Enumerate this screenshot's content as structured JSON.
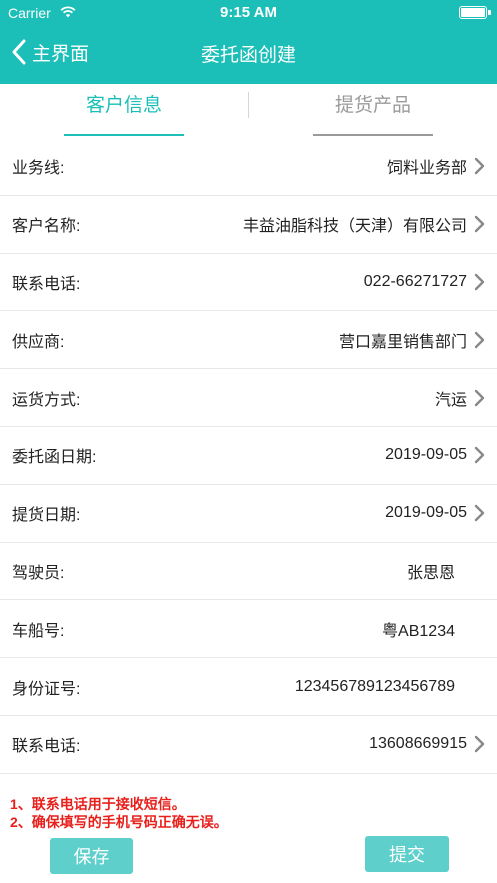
{
  "status": {
    "carrier": "Carrier",
    "time": "9:15 AM"
  },
  "nav": {
    "back_label": "主界面",
    "title": "委托函创建"
  },
  "tabs": [
    {
      "label": "客户信息",
      "active": true
    },
    {
      "label": "提货产品",
      "active": false
    }
  ],
  "fields": [
    {
      "label": "业务线:",
      "value": "饲料业务部"
    },
    {
      "label": "客户名称:",
      "value": "丰益油脂科技（天津）有限公司"
    },
    {
      "label": "联系电话:",
      "value": "022-66271727"
    },
    {
      "label": "供应商:",
      "value": "营口嘉里销售部门"
    },
    {
      "label": "运货方式:",
      "value": "汽运"
    },
    {
      "label": "委托函日期:",
      "value": "2019-09-05"
    },
    {
      "label": "提货日期:",
      "value": "2019-09-05"
    },
    {
      "label": "驾驶员:",
      "value": "张思恩"
    },
    {
      "label": "车船号:",
      "value": "粤AB1234"
    },
    {
      "label": "身份证号:",
      "value": "123456789123456789"
    },
    {
      "label": "联系电话:",
      "value": "13608669915"
    }
  ],
  "notes": [
    "1、联系电话用于接收短信。",
    "2、确保填写的手机号码正确无误。"
  ],
  "buttons": {
    "save": "保存",
    "submit": "提交"
  },
  "colors": {
    "primary": "#1bbfb8",
    "button": "#5ecfcb",
    "note": "#e8201c"
  }
}
